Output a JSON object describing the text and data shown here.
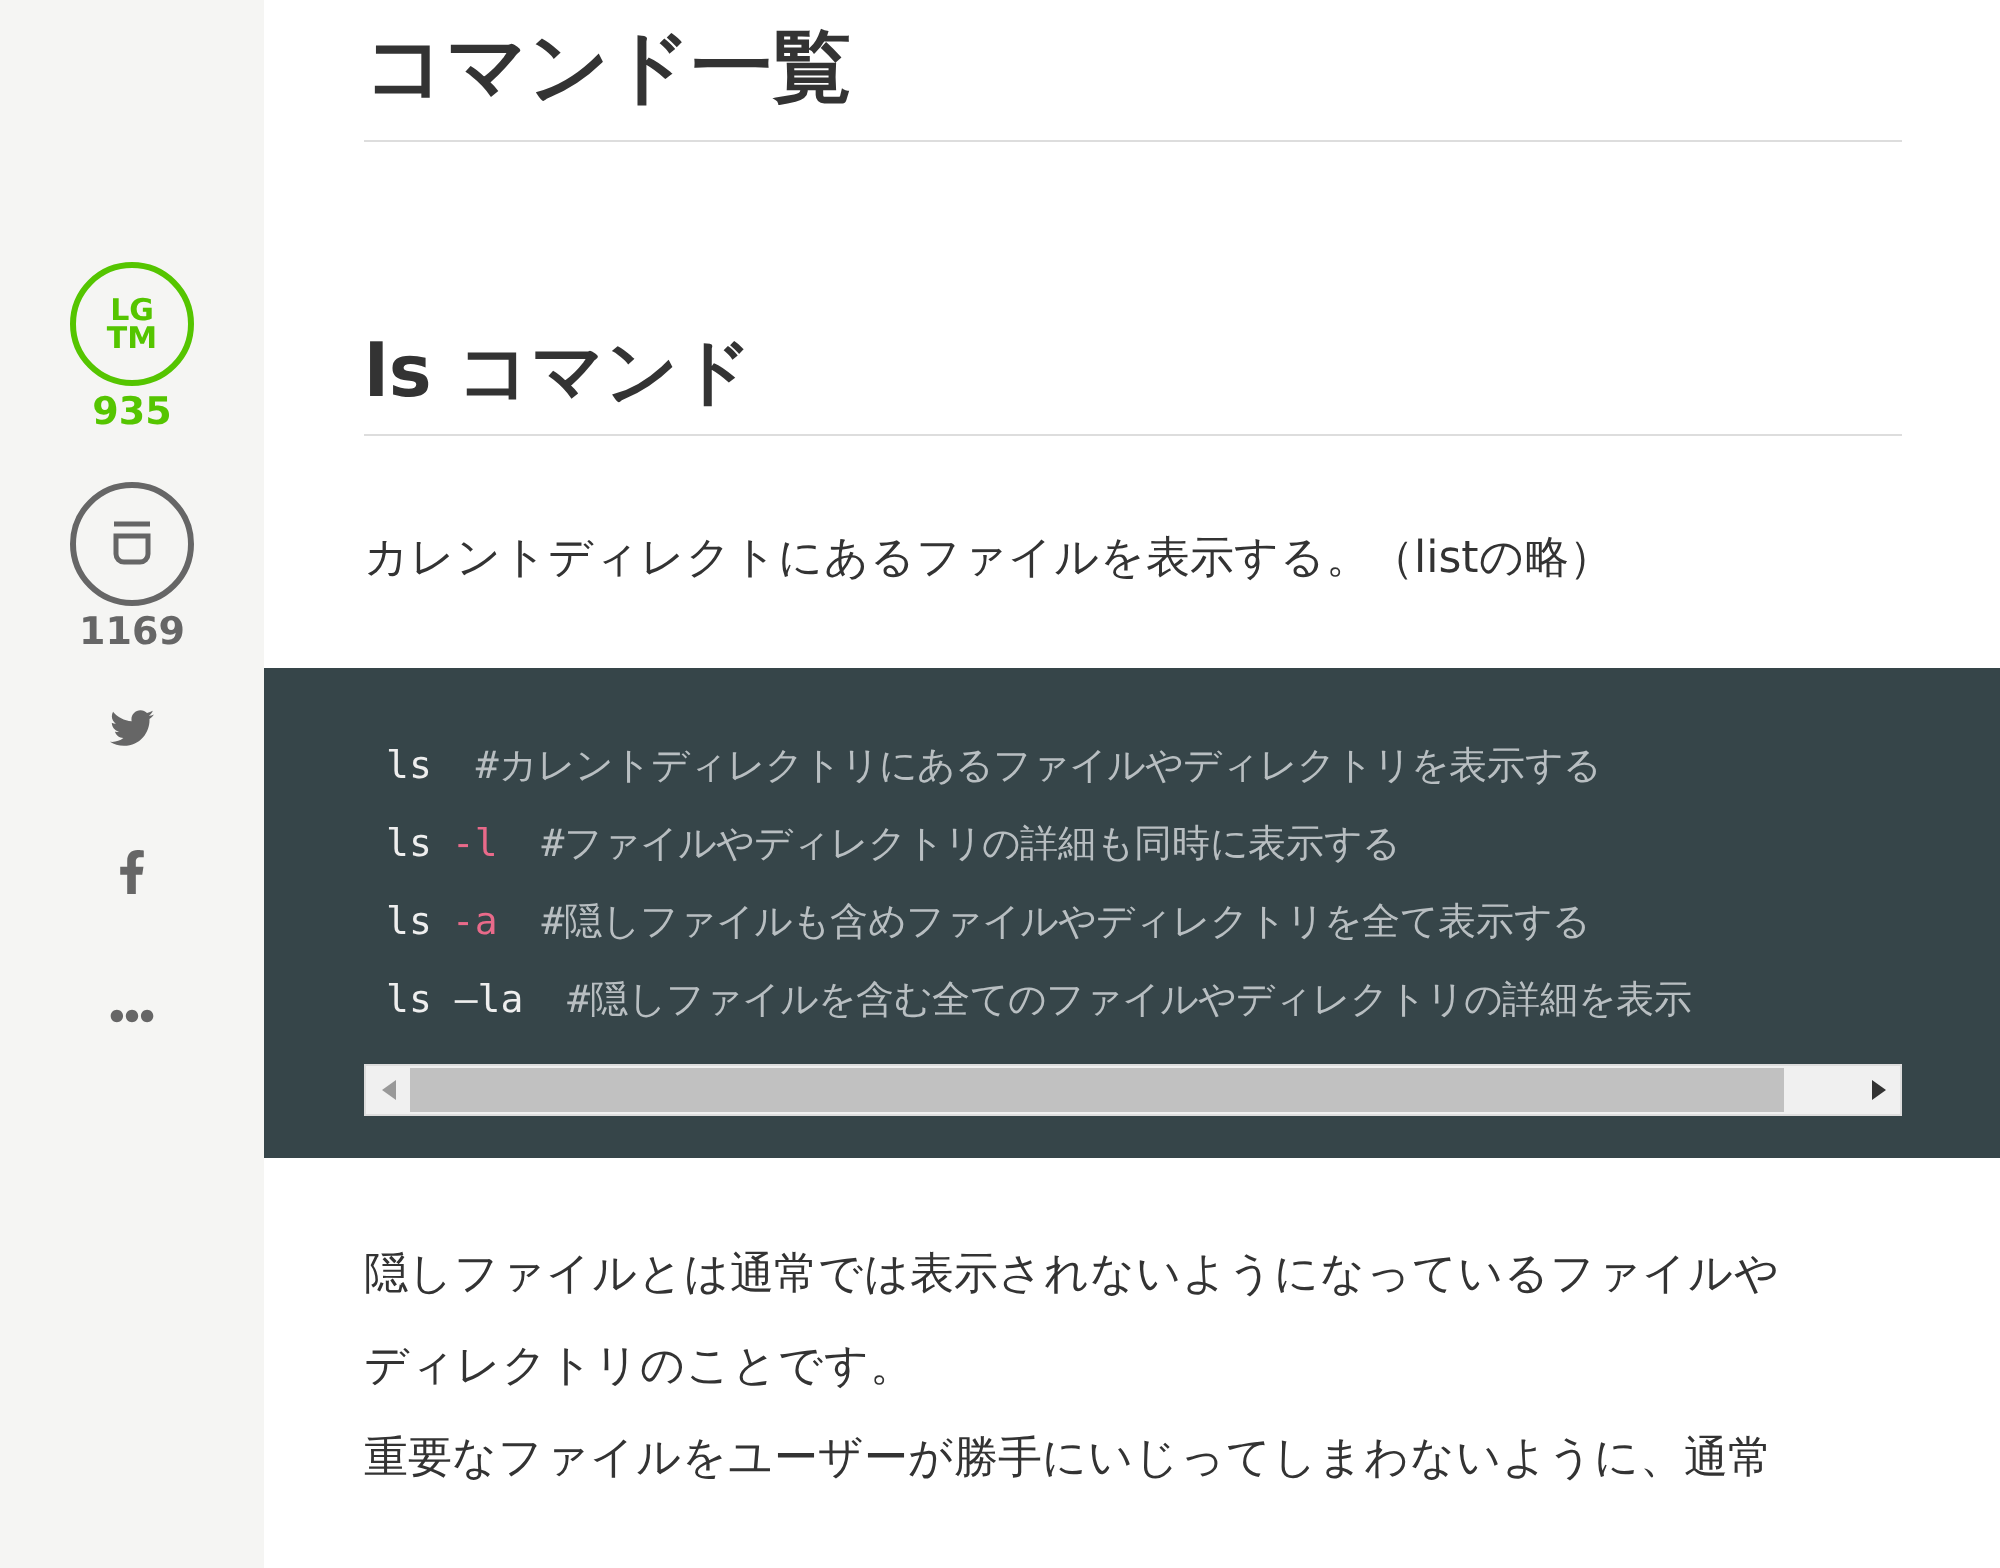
{
  "sidebar": {
    "lgtm": {
      "label_lines": [
        "LG",
        "TM"
      ],
      "count": "935",
      "active": true
    },
    "stock": {
      "count": "1169"
    },
    "share": [
      {
        "kind": "twitter"
      },
      {
        "kind": "facebook"
      },
      {
        "kind": "more"
      }
    ]
  },
  "article": {
    "title": "コマンド一覧",
    "section": "ls コマンド",
    "intro": "カレントディレクトにあるファイルを表示する。（listの略）",
    "code": [
      {
        "segments": [
          {
            "kind": "command",
            "text": "ls"
          },
          {
            "kind": "comment",
            "text": "#カレントディレクトリにあるファイルやディレクトリを表示する"
          }
        ]
      },
      {
        "segments": [
          {
            "kind": "command",
            "text": "ls"
          },
          {
            "kind": "option",
            "text": "-l"
          },
          {
            "kind": "comment",
            "text": "#ファイルやディレクトリの詳細も同時に表示する"
          }
        ]
      },
      {
        "segments": [
          {
            "kind": "command",
            "text": "ls"
          },
          {
            "kind": "option",
            "text": "-a"
          },
          {
            "kind": "comment",
            "text": "#隠しファイルも含めファイルやディレクトリを全て表示する"
          }
        ]
      },
      {
        "segments": [
          {
            "kind": "command",
            "text": "ls –la"
          },
          {
            "kind": "comment",
            "text": "#隠しファイルを含む全てのファイルやディレクトリの詳細を表示"
          }
        ]
      }
    ],
    "paragraphs": [
      [
        "隠しファイルとは通常では表示されないようになっているファイルや",
        "ディレクトリのことです。"
      ],
      [
        "重要なファイルをユーザーが勝手にいじってしまわないように、通常"
      ]
    ]
  }
}
